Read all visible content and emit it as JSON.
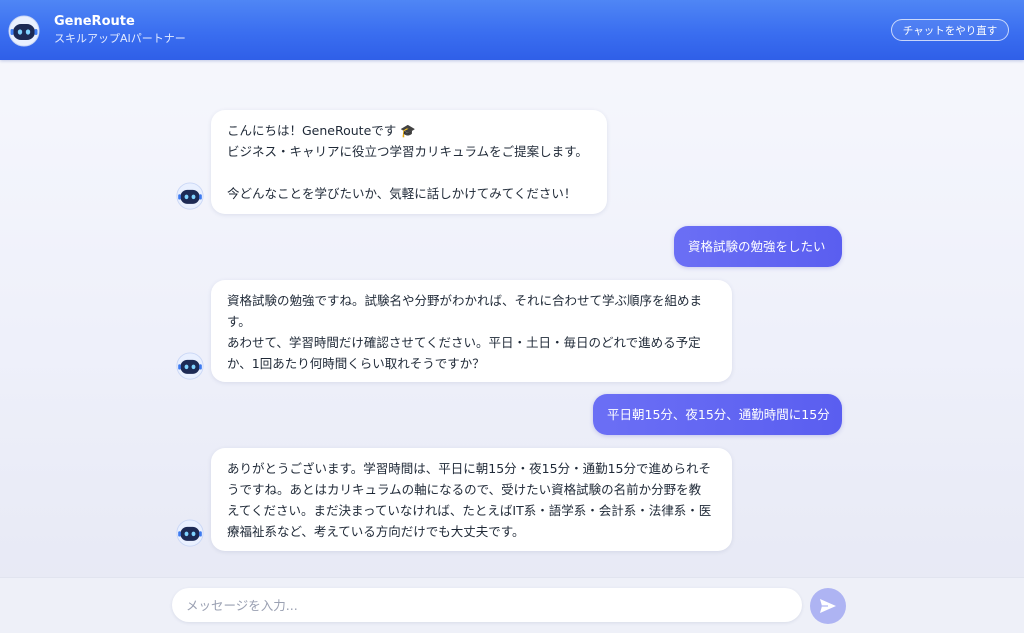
{
  "header": {
    "title": "GeneRoute",
    "subtitle": "スキルアップAIパートナー",
    "reset_label": "チャットをやり直す"
  },
  "messages": [
    {
      "role": "bot",
      "text": "こんにちは！GeneRouteです 🎓\nビジネス・キャリアに役立つ学習カリキュラムをご提案します。\n\n今どんなことを学びたいか、気軽に話しかけてみてください！"
    },
    {
      "role": "user",
      "text": "資格試験の勉強をしたい"
    },
    {
      "role": "bot",
      "text": "資格試験の勉強ですね。試験名や分野がわかれば、それに合わせて学ぶ順序を組めま\nす。\nあわせて、学習時間だけ確認させてください。平日・土日・毎日のどれで進める予定\nか、1回あたり何時間くらい取れそうですか？"
    },
    {
      "role": "user",
      "text": "平日朝15分、夜15分、通勤時間に15分"
    },
    {
      "role": "bot",
      "text": "ありがとうございます。学習時間は、平日に朝15分・夜15分・通勤15分で進められそ\nうですね。あとはカリキュラムの軸になるので、受けたい資格試験の名前か分野を教\nえてください。まだ決まっていなければ、たとえばIT系・語学系・会計系・法律系・医\n療福祉系など、考えている方向だけでも大丈夫です。"
    }
  ],
  "composer": {
    "placeholder": "メッセージを入力..."
  },
  "icons": {
    "logo": "robot-icon",
    "bot_avatar": "robot-icon",
    "send": "paper-plane-icon"
  },
  "colors": {
    "header": "#3a6ef0",
    "user_bubble": "#5a5ef0",
    "send_button": "#aeb4f3"
  }
}
